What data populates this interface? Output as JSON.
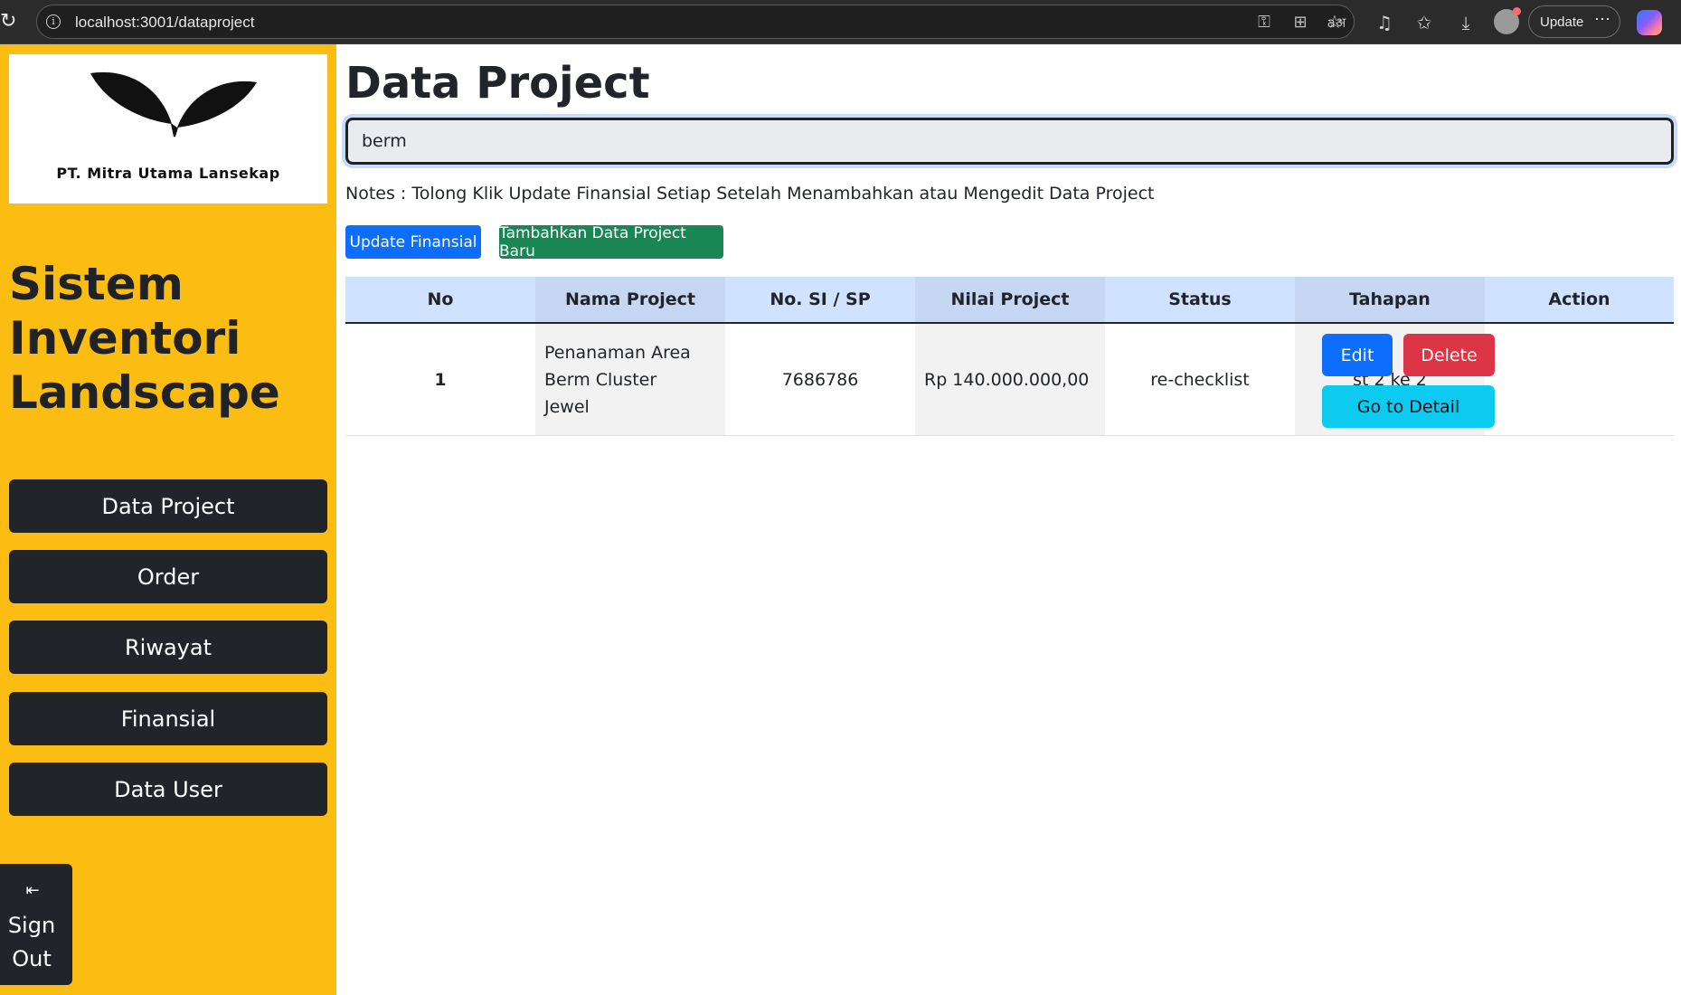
{
  "browser": {
    "url": "localhost:3001/dataproject",
    "update_label": "Update",
    "more_icon": "ellipsis-icon",
    "reload_icon": "reload-icon",
    "info_icon": "info-icon",
    "toolbar_icons": [
      "key-icon",
      "grid-icon",
      "translate-icon",
      "star-icon",
      "music-icon",
      "favorites-icon",
      "download-icon",
      "profile-icon",
      "copilot-icon"
    ]
  },
  "sidebar": {
    "logo_text": "PT. Mitra Utama Lansekap",
    "brand_title": "Sistem Inventori Landscape",
    "nav": [
      {
        "label": "Data Project"
      },
      {
        "label": "Order"
      },
      {
        "label": "Riwayat"
      },
      {
        "label": "Finansial"
      },
      {
        "label": "Data User"
      }
    ],
    "signout": {
      "label": "Sign Out",
      "icon": "sign-out-icon"
    },
    "colors": {
      "background": "#fcbd13",
      "button": "#212529"
    }
  },
  "main": {
    "title": "Data Project",
    "search": {
      "value": "berm",
      "placeholder": ""
    },
    "notes": "Notes : Tolong Klik Update Finansial Setiap Setelah Menambahkan atau Mengedit Data Project",
    "buttons": {
      "update_finansial": "Update Finansial",
      "tambah_project": "Tambahkan Data Project Baru"
    },
    "table": {
      "headers": [
        "No",
        "Nama Project",
        "No. SI / SP",
        "Nilai Project",
        "Status",
        "Tahapan",
        "Action"
      ],
      "rows": [
        {
          "no": "1",
          "nama_project": "Penanaman Area Berm Cluster Jewel",
          "no_si_sp": "7686786",
          "nilai_project": "Rp 140.000.000,00",
          "status": "re-checklist",
          "tahapan": "st 2 ke 2",
          "actions": {
            "edit": "Edit",
            "delete": "Delete",
            "detail": "Go to Detail"
          }
        }
      ]
    },
    "colors": {
      "primary": "#0d6efd",
      "success": "#198754",
      "danger": "#dc3545",
      "info": "#0dcaf0",
      "header": "#cfe2ff"
    }
  }
}
